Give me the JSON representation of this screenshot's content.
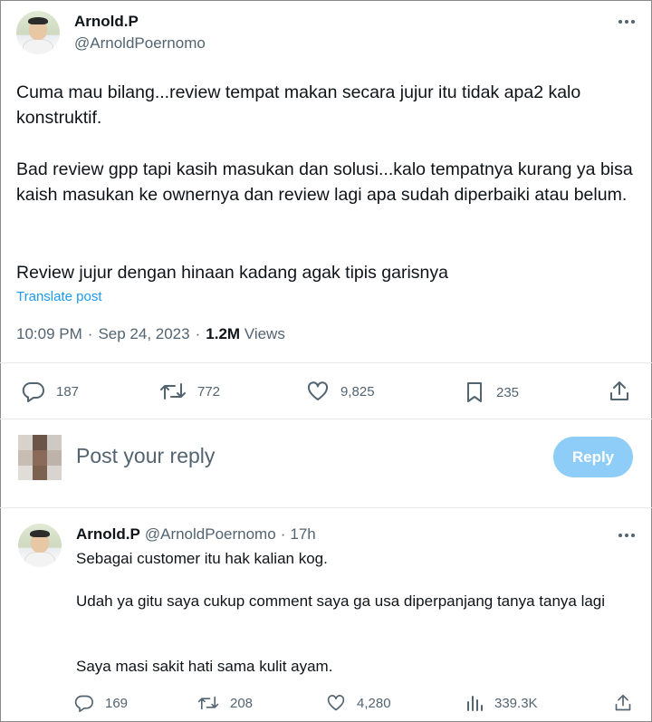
{
  "tweet": {
    "author_name": "Arnold.P",
    "author_handle": "@ArnoldPoernomo",
    "paragraphs": [
      "Cuma mau bilang...review tempat makan secara jujur itu tidak apa2 kalo konstruktif.",
      "Bad review gpp tapi kasih masukan dan solusi...kalo tempatnya kurang ya bisa kaish masukan ke ownernya dan review lagi apa sudah diperbaiki atau belum.",
      "Review jujur dengan hinaan kadang agak tipis garisnya"
    ],
    "translate_label": "Translate post",
    "time": "10:09 PM",
    "date": "Sep 24, 2023",
    "separator": "·",
    "views_count": "1.2M",
    "views_label": "Views",
    "stats": {
      "replies": "187",
      "reposts": "772",
      "likes": "9,825",
      "bookmarks": "235"
    }
  },
  "composer": {
    "placeholder": "Post your reply",
    "reply_button": "Reply"
  },
  "reply": {
    "author_name": "Arnold.P",
    "author_handle": "@ArnoldPoernomo",
    "separator": "·",
    "age": "17h",
    "paragraphs": [
      "Sebagai customer itu hak kalian kog.",
      "Udah ya gitu saya cukup comment saya ga usa diperpanjang tanya tanya lagi",
      "Saya masi sakit hati sama kulit ayam."
    ],
    "stats": {
      "replies": "169",
      "reposts": "208",
      "likes": "4,280",
      "views": "339.3K"
    }
  },
  "colors": {
    "accent": "#1d9bf0",
    "reply_button": "#8ecdf8",
    "secondary_text": "#536471"
  }
}
